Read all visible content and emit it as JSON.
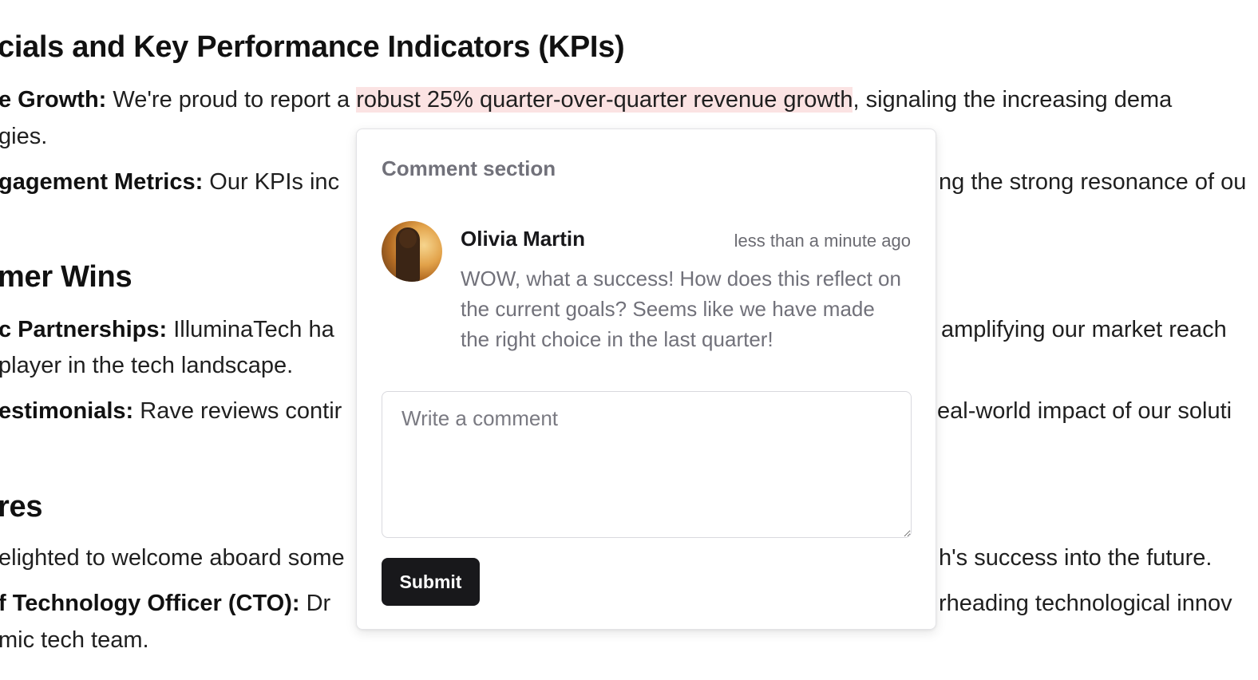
{
  "document": {
    "heading_kpis": "cials and Key Performance Indicators (KPIs)",
    "revenue": {
      "label": "e Growth:",
      "text_before": " We're proud to report a ",
      "highlight": "robust 25% quarter-over-quarter revenue growth",
      "text_after": ", signaling the increasing dema",
      "continuation": "gies."
    },
    "engagement": {
      "label": "gagement Metrics:",
      "text_left": " Our KPIs inc",
      "text_right": "ng the strong resonance of ou"
    },
    "heading_wins": "mer Wins",
    "partnerships": {
      "label": "c Partnerships:",
      "text_left": " IlluminaTech ha",
      "text_right": "amplifying our market reach",
      "continuation": "player in the tech landscape."
    },
    "testimonials": {
      "label": "estimonials:",
      "text_left": " Rave reviews contir",
      "text_right": "eal-world impact of our soluti"
    },
    "heading_hires": "res",
    "hires_intro": {
      "text_left": "elighted to welcome aboard some",
      "text_right": "h's success into the future."
    },
    "cto": {
      "label": "f Technology Officer (CTO):",
      "text_left": " Dr",
      "text_right": "rheading technological innov",
      "continuation": "mic tech team."
    }
  },
  "comment_popover": {
    "title": "Comment section",
    "comment": {
      "author": "Olivia Martin",
      "time": "less than a minute ago",
      "text": "WOW, what a success! How does this reflect on the current goals? Seems like we have made the right choice in the last quarter!"
    },
    "input": {
      "placeholder": "Write a comment",
      "value": ""
    },
    "submit_label": "Submit"
  },
  "colors": {
    "highlight": "#fbe3e3",
    "button": "#18181b",
    "muted_text": "#71717a"
  }
}
